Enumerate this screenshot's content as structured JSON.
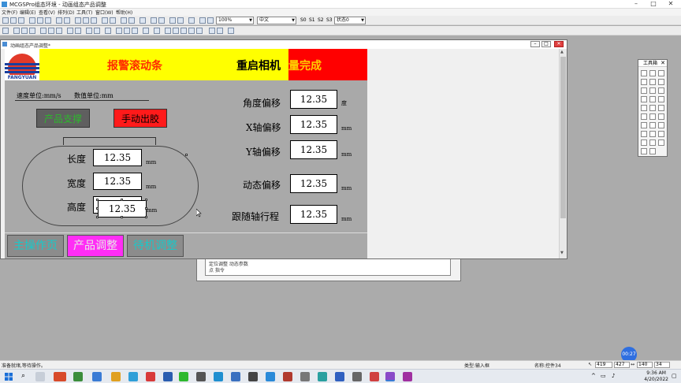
{
  "app": {
    "title": "MCGSPro组态环境 - 动画组态产品调整",
    "menu": [
      "文件(F)",
      "编辑(E)",
      "查看(V)",
      "排列(D)",
      "工具(T)",
      "窗口(W)",
      "帮助(H)"
    ],
    "zoom": "100%",
    "font": "中文",
    "states": [
      "S0",
      "S1",
      "S2",
      "S3"
    ],
    "state_select": "状态0"
  },
  "child_window": {
    "title": "动画组态产品调整*"
  },
  "screen": {
    "logo_text": "FANGYUAN",
    "banner_left": "报警滚动条",
    "banner_mid": "重启相机",
    "banner_right": "量完成",
    "speed_unit": "速度单位:mm/s",
    "value_unit": "数值单位:mm",
    "btn_product_support": "产品支撑",
    "btn_manual_glue": "手动出胶",
    "fields": {
      "length_label": "长度",
      "length_value": "12.35",
      "length_unit": "mm",
      "width_label": "宽度",
      "width_value": "12.35",
      "width_unit": "mm",
      "height_label": "高度",
      "height_value": "12.35",
      "height_unit": "mm",
      "angle_label": "角度偏移",
      "angle_value": "12.35",
      "angle_unit": "度",
      "x_label": "X轴偏移",
      "x_value": "12.35",
      "x_unit": "mm",
      "y_label": "Y轴偏移",
      "y_value": "12.35",
      "y_unit": "mm",
      "dynamic_label": "动态偏移",
      "dynamic_value": "12.35",
      "dynamic_unit": "mm",
      "follow_label": "跟随轴行程",
      "follow_value": "12.35",
      "follow_unit": "mm"
    },
    "nav": {
      "main": "主操作页",
      "product": "产品调整",
      "standby": "待机调整"
    }
  },
  "back_window": {
    "row1": "定位调整 动态参数",
    "row2": "点    指令"
  },
  "toolbox": {
    "title": "工具箱"
  },
  "status": {
    "left": "准备就绪,等待操作。",
    "type": "类型:输入框",
    "name": "名称:控件34",
    "x": "419",
    "y": "427",
    "w": "140",
    "h": "34"
  },
  "taskbar": {
    "time": "9:36 AM",
    "date": "4/20/2022"
  },
  "recorder": "00:27",
  "colors": {
    "banner_yellow": "#ffff00",
    "banner_red": "#ff0000",
    "btn_support_bg": "#5f5f5f",
    "btn_support_fg": "#2db82d",
    "btn_glue_bg": "#ff1a1a",
    "nav_main_bg": "#8c8c8c",
    "nav_product_bg": "#ff2df5",
    "nav_text": "#19c9c9"
  }
}
